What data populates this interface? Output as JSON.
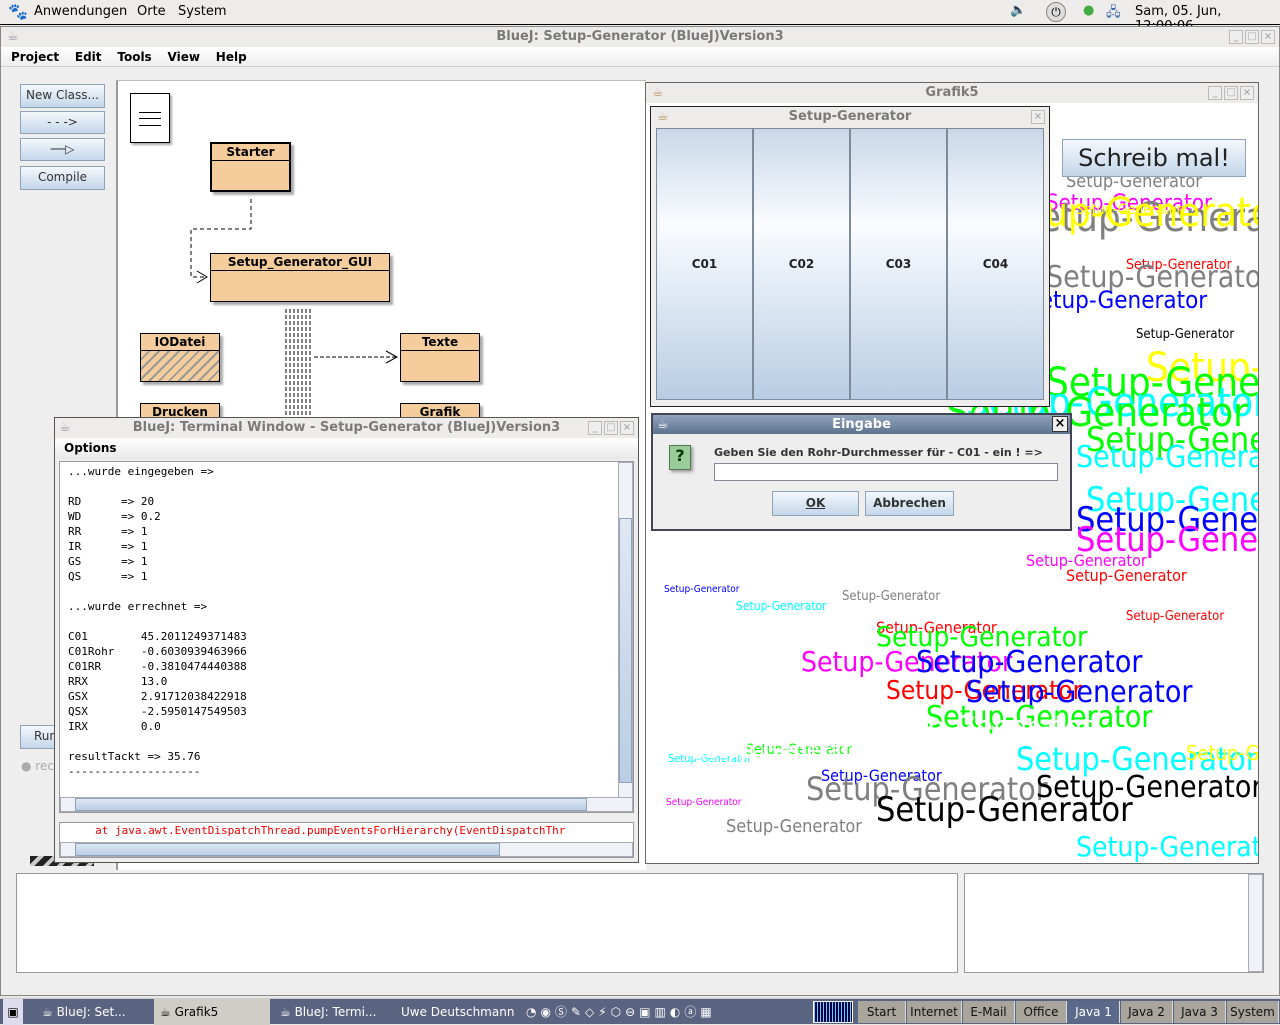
{
  "top_panel": {
    "menus": [
      "Anwendungen",
      "Orte",
      "System"
    ],
    "clock": "Sam, 05. Jun, 12:00:06"
  },
  "bluej": {
    "title": "BlueJ:  Setup-Generator (BlueJ)Version3",
    "menu": [
      "Project",
      "Edit",
      "Tools",
      "View",
      "Help"
    ],
    "toolbar": {
      "new_class": "New Class...",
      "compile": "Compile",
      "run": "Run",
      "record": "rec"
    },
    "classes": {
      "starter": "Starter",
      "gui": "Setup_Generator_GUI",
      "iodatei": "IODatei",
      "texte": "Texte",
      "drucken": "Drucken",
      "grafik": "Grafik"
    }
  },
  "terminal": {
    "title": "BlueJ: Terminal Window - Setup-Generator (BlueJ)Version3",
    "menu": "Options",
    "lines": [
      "...wurde eingegeben =>",
      "",
      "RD      => 20",
      "WD      => 0.2",
      "RR      => 1",
      "IR      => 1",
      "GS      => 1",
      "QS      => 1",
      "",
      "...wurde errechnet =>",
      "",
      "C01        45.2011249371483",
      "C01Rohr    -0.6030939463966",
      "C01RR      -0.3810474440388",
      "RRX        13.0",
      "GSX        2.91712038422918",
      "QSX        -2.5950147549503",
      "IRX        0.0",
      "",
      "resultTackt => 35.76",
      "--------------------"
    ],
    "error": "     at java.awt.EventDispatchThread.pumpEventsForHierarchy(EventDispatchThr"
  },
  "grafik": {
    "title": "Grafik5",
    "schreib_button": "Schreib mal!",
    "art_text": "Setup-Generator",
    "art_colors": [
      "#ff00ff",
      "#ffff00",
      "#00ff00",
      "#00ffff",
      "#0000ff",
      "#ff0000",
      "#808080",
      "#000000",
      "#ffffff"
    ]
  },
  "setup_generator": {
    "title": "Setup-Generator",
    "columns": [
      "C01",
      "C02",
      "C03",
      "C04"
    ]
  },
  "eingabe": {
    "title": "Eingabe",
    "prompt": "Geben Sie den Rohr-Durchmesser für - C01 - ein ! =>",
    "value": "",
    "ok": "OK",
    "cancel": "Abbrechen"
  },
  "taskbar": {
    "tasks": [
      "BlueJ:  Set...",
      "Grafik5",
      "BlueJ: Termi..."
    ],
    "user": "Uwe Deutschmann",
    "workspaces": [
      "Start",
      "Internet",
      "E-Mail",
      "Office",
      "Java 1",
      "Java 2",
      "Java 3",
      "System"
    ],
    "active_workspace": "Java 1"
  }
}
